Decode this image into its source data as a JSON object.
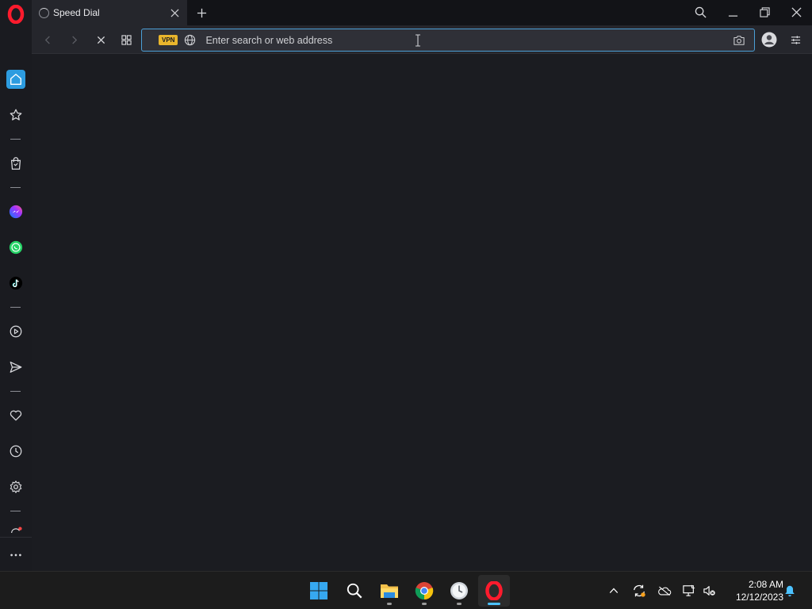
{
  "browser": {
    "tab": {
      "title": "Speed Dial"
    },
    "address_bar": {
      "vpn_label": "VPN",
      "placeholder": "Enter search or web address",
      "value": ""
    }
  },
  "sidebar": {
    "items": [
      {
        "name": "home",
        "icon": "home-icon",
        "active": true
      },
      {
        "name": "bookmarks",
        "icon": "star-icon"
      },
      {
        "name": "shopping",
        "icon": "shopping-bag-icon"
      },
      {
        "name": "messenger",
        "icon": "messenger-icon"
      },
      {
        "name": "whatsapp",
        "icon": "whatsapp-icon"
      },
      {
        "name": "tiktok",
        "icon": "tiktok-icon"
      },
      {
        "name": "player",
        "icon": "player-icon"
      },
      {
        "name": "flow",
        "icon": "send-icon"
      },
      {
        "name": "pinboards",
        "icon": "heart-icon"
      },
      {
        "name": "history",
        "icon": "clock-icon"
      },
      {
        "name": "settings",
        "icon": "gear-icon"
      },
      {
        "name": "update",
        "icon": "refresh-icon"
      },
      {
        "name": "more",
        "icon": "more-icon"
      }
    ]
  },
  "taskbar": {
    "apps": [
      {
        "name": "start",
        "icon": "windows-icon"
      },
      {
        "name": "search",
        "icon": "search-icon"
      },
      {
        "name": "file-explorer",
        "icon": "folder-icon",
        "running": true
      },
      {
        "name": "chrome",
        "icon": "chrome-icon",
        "running": true
      },
      {
        "name": "clock-app",
        "icon": "clock-app-icon",
        "running": true
      },
      {
        "name": "opera",
        "icon": "opera-icon",
        "running": true,
        "active": true
      }
    ],
    "clock": {
      "time": "2:08 AM",
      "date": "12/12/2023"
    }
  },
  "colors": {
    "accent": "#2d9ce0",
    "opera_red": "#ff1b2d",
    "vpn_badge": "#e9b52c",
    "taskbar_active": "#4cc2ff"
  }
}
